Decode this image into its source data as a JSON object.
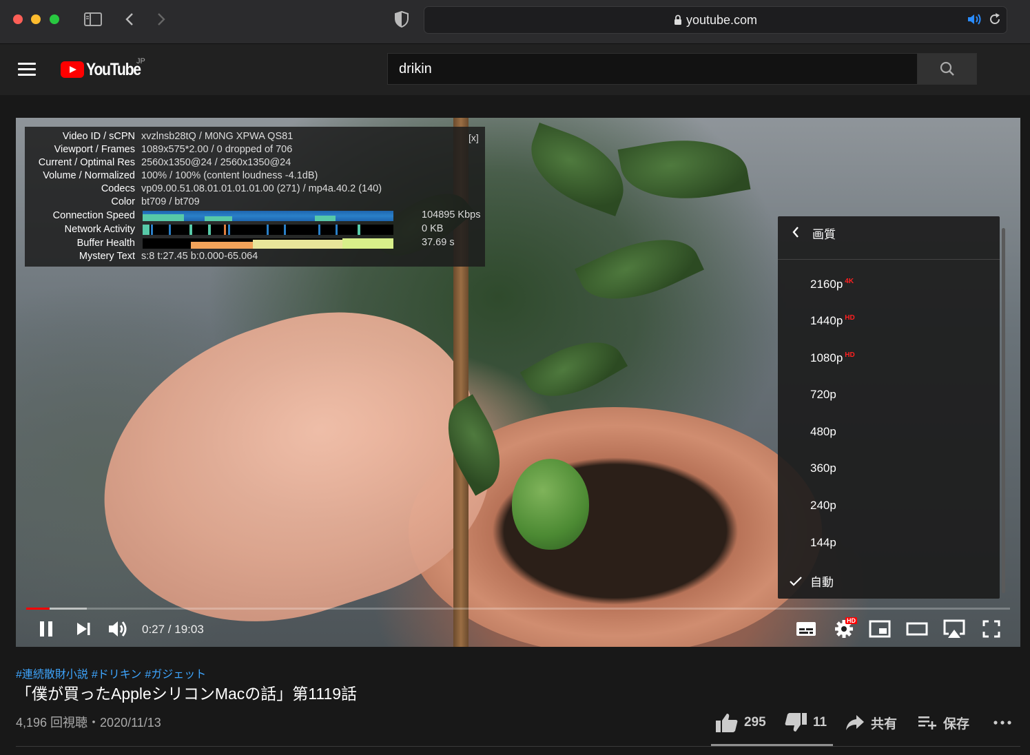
{
  "browser": {
    "url": "youtube.com"
  },
  "header": {
    "logo_text": "YouTube",
    "region": "JP",
    "search_value": "drikin"
  },
  "stats": {
    "close_label": "[x]",
    "rows": [
      {
        "label": "Video ID / sCPN",
        "value": "xvzlnsb28tQ / M0NG XPWA QS81"
      },
      {
        "label": "Viewport / Frames",
        "value": "1089x575*2.00 / 0 dropped of 706"
      },
      {
        "label": "Current / Optimal Res",
        "value": "2560x1350@24 / 2560x1350@24"
      },
      {
        "label": "Volume / Normalized",
        "value": "100% / 100% (content loudness -4.1dB)"
      },
      {
        "label": "Codecs",
        "value": "vp09.00.51.08.01.01.01.01.00 (271) / mp4a.40.2 (140)"
      },
      {
        "label": "Color",
        "value": "bt709 / bt709"
      }
    ],
    "connection_label": "Connection Speed",
    "connection_value": "104895 Kbps",
    "network_label": "Network Activity",
    "network_value": "0 KB",
    "buffer_label": "Buffer Health",
    "buffer_value": "37.69 s",
    "mystery_label": "Mystery Text",
    "mystery_value": "s:8 t:27.45 b:0.000-65.064"
  },
  "quality_menu": {
    "title": "画質",
    "items": [
      {
        "label": "2160p",
        "badge": "4K"
      },
      {
        "label": "1440p",
        "badge": "HD"
      },
      {
        "label": "1080p",
        "badge": "HD"
      },
      {
        "label": "720p",
        "badge": ""
      },
      {
        "label": "480p",
        "badge": ""
      },
      {
        "label": "360p",
        "badge": ""
      },
      {
        "label": "240p",
        "badge": ""
      },
      {
        "label": "144p",
        "badge": ""
      },
      {
        "label": "自動",
        "badge": ""
      }
    ],
    "selected": "自動"
  },
  "player": {
    "time": "0:27 / 19:03",
    "progress": 0.0236,
    "buffered": 0.0616,
    "settings_badge": "HD"
  },
  "video": {
    "tags": [
      "#連続散財小説",
      "#ドリキン",
      "#ガジェット"
    ],
    "title": "「僕が買ったAppleシリコンMacの話」第1119話",
    "meta": "4,196 回視聴・2020/11/13",
    "likes": "295",
    "dislikes": "11",
    "share_label": "共有",
    "save_label": "保存"
  },
  "colors": {
    "accent_red": "#ff0000",
    "link_blue": "#3ea6ff"
  }
}
